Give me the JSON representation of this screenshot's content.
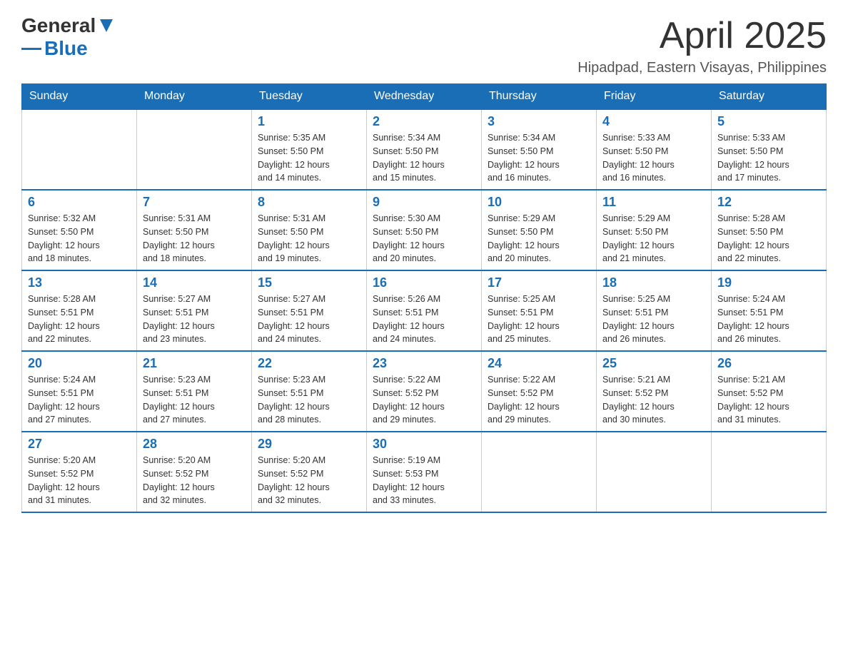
{
  "header": {
    "logo_general": "General",
    "logo_blue": "Blue",
    "month_title": "April 2025",
    "subtitle": "Hipadpad, Eastern Visayas, Philippines"
  },
  "days_of_week": [
    "Sunday",
    "Monday",
    "Tuesday",
    "Wednesday",
    "Thursday",
    "Friday",
    "Saturday"
  ],
  "weeks": [
    [
      {
        "day": "",
        "info": ""
      },
      {
        "day": "",
        "info": ""
      },
      {
        "day": "1",
        "info": "Sunrise: 5:35 AM\nSunset: 5:50 PM\nDaylight: 12 hours\nand 14 minutes."
      },
      {
        "day": "2",
        "info": "Sunrise: 5:34 AM\nSunset: 5:50 PM\nDaylight: 12 hours\nand 15 minutes."
      },
      {
        "day": "3",
        "info": "Sunrise: 5:34 AM\nSunset: 5:50 PM\nDaylight: 12 hours\nand 16 minutes."
      },
      {
        "day": "4",
        "info": "Sunrise: 5:33 AM\nSunset: 5:50 PM\nDaylight: 12 hours\nand 16 minutes."
      },
      {
        "day": "5",
        "info": "Sunrise: 5:33 AM\nSunset: 5:50 PM\nDaylight: 12 hours\nand 17 minutes."
      }
    ],
    [
      {
        "day": "6",
        "info": "Sunrise: 5:32 AM\nSunset: 5:50 PM\nDaylight: 12 hours\nand 18 minutes."
      },
      {
        "day": "7",
        "info": "Sunrise: 5:31 AM\nSunset: 5:50 PM\nDaylight: 12 hours\nand 18 minutes."
      },
      {
        "day": "8",
        "info": "Sunrise: 5:31 AM\nSunset: 5:50 PM\nDaylight: 12 hours\nand 19 minutes."
      },
      {
        "day": "9",
        "info": "Sunrise: 5:30 AM\nSunset: 5:50 PM\nDaylight: 12 hours\nand 20 minutes."
      },
      {
        "day": "10",
        "info": "Sunrise: 5:29 AM\nSunset: 5:50 PM\nDaylight: 12 hours\nand 20 minutes."
      },
      {
        "day": "11",
        "info": "Sunrise: 5:29 AM\nSunset: 5:50 PM\nDaylight: 12 hours\nand 21 minutes."
      },
      {
        "day": "12",
        "info": "Sunrise: 5:28 AM\nSunset: 5:50 PM\nDaylight: 12 hours\nand 22 minutes."
      }
    ],
    [
      {
        "day": "13",
        "info": "Sunrise: 5:28 AM\nSunset: 5:51 PM\nDaylight: 12 hours\nand 22 minutes."
      },
      {
        "day": "14",
        "info": "Sunrise: 5:27 AM\nSunset: 5:51 PM\nDaylight: 12 hours\nand 23 minutes."
      },
      {
        "day": "15",
        "info": "Sunrise: 5:27 AM\nSunset: 5:51 PM\nDaylight: 12 hours\nand 24 minutes."
      },
      {
        "day": "16",
        "info": "Sunrise: 5:26 AM\nSunset: 5:51 PM\nDaylight: 12 hours\nand 24 minutes."
      },
      {
        "day": "17",
        "info": "Sunrise: 5:25 AM\nSunset: 5:51 PM\nDaylight: 12 hours\nand 25 minutes."
      },
      {
        "day": "18",
        "info": "Sunrise: 5:25 AM\nSunset: 5:51 PM\nDaylight: 12 hours\nand 26 minutes."
      },
      {
        "day": "19",
        "info": "Sunrise: 5:24 AM\nSunset: 5:51 PM\nDaylight: 12 hours\nand 26 minutes."
      }
    ],
    [
      {
        "day": "20",
        "info": "Sunrise: 5:24 AM\nSunset: 5:51 PM\nDaylight: 12 hours\nand 27 minutes."
      },
      {
        "day": "21",
        "info": "Sunrise: 5:23 AM\nSunset: 5:51 PM\nDaylight: 12 hours\nand 27 minutes."
      },
      {
        "day": "22",
        "info": "Sunrise: 5:23 AM\nSunset: 5:51 PM\nDaylight: 12 hours\nand 28 minutes."
      },
      {
        "day": "23",
        "info": "Sunrise: 5:22 AM\nSunset: 5:52 PM\nDaylight: 12 hours\nand 29 minutes."
      },
      {
        "day": "24",
        "info": "Sunrise: 5:22 AM\nSunset: 5:52 PM\nDaylight: 12 hours\nand 29 minutes."
      },
      {
        "day": "25",
        "info": "Sunrise: 5:21 AM\nSunset: 5:52 PM\nDaylight: 12 hours\nand 30 minutes."
      },
      {
        "day": "26",
        "info": "Sunrise: 5:21 AM\nSunset: 5:52 PM\nDaylight: 12 hours\nand 31 minutes."
      }
    ],
    [
      {
        "day": "27",
        "info": "Sunrise: 5:20 AM\nSunset: 5:52 PM\nDaylight: 12 hours\nand 31 minutes."
      },
      {
        "day": "28",
        "info": "Sunrise: 5:20 AM\nSunset: 5:52 PM\nDaylight: 12 hours\nand 32 minutes."
      },
      {
        "day": "29",
        "info": "Sunrise: 5:20 AM\nSunset: 5:52 PM\nDaylight: 12 hours\nand 32 minutes."
      },
      {
        "day": "30",
        "info": "Sunrise: 5:19 AM\nSunset: 5:53 PM\nDaylight: 12 hours\nand 33 minutes."
      },
      {
        "day": "",
        "info": ""
      },
      {
        "day": "",
        "info": ""
      },
      {
        "day": "",
        "info": ""
      }
    ]
  ]
}
